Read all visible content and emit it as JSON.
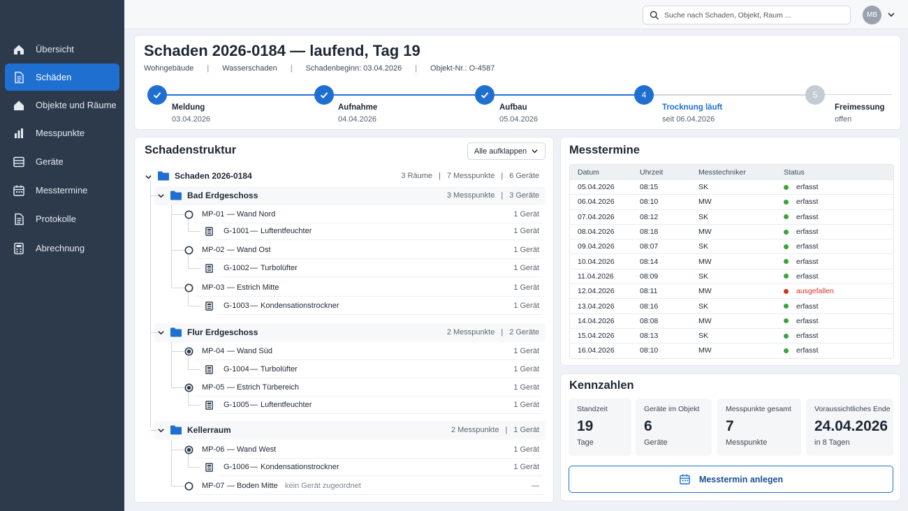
{
  "colors": {
    "accent": "#1f6fd1",
    "sidebar": "#2c3a4b",
    "ok": "#3aa33a",
    "fail": "#d93025"
  },
  "nav": [
    {
      "label": "Übersicht",
      "icon": "home-icon"
    },
    {
      "label": "Schäden",
      "icon": "document-icon",
      "active": true
    },
    {
      "label": "Objekte und Räume",
      "icon": "building-icon"
    },
    {
      "label": "Messpunkte",
      "icon": "bar-chart-icon"
    },
    {
      "label": "Geräte",
      "icon": "device-icon"
    },
    {
      "label": "Messtermine",
      "icon": "calendar-icon"
    },
    {
      "label": "Protokolle",
      "icon": "document-icon"
    },
    {
      "label": "Abrechnung",
      "icon": "calculator-icon"
    }
  ],
  "topbar": {
    "search_placeholder": "Suche nach Schaden, Objekt, Raum ...",
    "avatar_initials": "MB"
  },
  "header": {
    "title": "Schaden 2026-0184 — laufend, Tag 19",
    "meta": [
      "Wohngebäude",
      "Wasserschaden",
      "Schadenbeginn: 03.04.2026",
      "Objekt-Nr.: O-4587"
    ],
    "steps": [
      {
        "number": "1",
        "name": "Meldung",
        "date": "03.04.2026",
        "state": "done"
      },
      {
        "number": "2",
        "name": "Aufnahme",
        "date": "04.04.2026",
        "state": "done"
      },
      {
        "number": "3",
        "name": "Aufbau",
        "date": "05.04.2026",
        "state": "done"
      },
      {
        "number": "4",
        "name": "Trocknung läuft",
        "date": "seit 06.04.2026",
        "state": "current"
      },
      {
        "number": "5",
        "name": "Freimessung",
        "date": "offen",
        "state": "todo"
      }
    ]
  },
  "structure": {
    "title": "Schadenstruktur",
    "expand_label": "Alle aufklappen",
    "root": {
      "name": "Schaden 2026-0184",
      "rooms": "3 Räume",
      "points": "7 Messpunkte",
      "devices": "6 Geräte"
    },
    "rooms": [
      {
        "name": "Bad Erdgeschoss",
        "points": "3 Messpunkte",
        "devices": "3 Geräte",
        "items": [
          {
            "id": "MP-01",
            "label": "Wand Nord",
            "right": "1 Gerät",
            "filled": false,
            "device": {
              "id": "G-1001",
              "label": "Luftentfeuchter",
              "right": "1 Gerät"
            }
          },
          {
            "id": "MP-02",
            "label": "Wand Ost",
            "right": "1 Gerät",
            "filled": false,
            "device": {
              "id": "G-1002",
              "label": "Turbolüfter",
              "right": "1 Gerät"
            }
          },
          {
            "id": "MP-03",
            "label": "Estrich Mitte",
            "right": "1 Gerät",
            "filled": false,
            "device": {
              "id": "G-1003",
              "label": "Kondensationstrockner",
              "right": "1 Gerät"
            }
          }
        ]
      },
      {
        "name": "Flur Erdgeschoss",
        "points": "2 Messpunkte",
        "devices": "2 Geräte",
        "items": [
          {
            "id": "MP-04",
            "label": "Wand Süd",
            "right": "1 Gerät",
            "filled": true,
            "device": {
              "id": "G-1004",
              "label": "Turbolüfter",
              "right": "1 Gerät"
            }
          },
          {
            "id": "MP-05",
            "label": "Estrich Türbereich",
            "right": "1 Gerät",
            "filled": true,
            "device": {
              "id": "G-1005",
              "label": "Luftentfeuchter",
              "right": "1 Gerät"
            }
          }
        ]
      },
      {
        "name": "Kellerraum",
        "points": "2 Messpunkte",
        "devices": "1 Gerät",
        "items": [
          {
            "id": "MP-06",
            "label": "Wand West",
            "right": "1 Gerät",
            "filled": true,
            "device": {
              "id": "G-1006",
              "label": "Kondensationstrockner",
              "right": "1 Gerät"
            }
          },
          {
            "id": "MP-07",
            "label": "Boden Mitte",
            "note": "kein Gerät zugeordnet",
            "right": "—",
            "filled": false
          }
        ]
      }
    ]
  },
  "messtermine": {
    "title": "Messtermine",
    "columns": [
      "Datum",
      "Uhrzeit",
      "Messtechniker",
      "Status"
    ],
    "rows": [
      {
        "date": "05.04.2026",
        "time": "08:15",
        "tech": "SK",
        "status": "erfasst",
        "ok": true
      },
      {
        "date": "06.04.2026",
        "time": "08:10",
        "tech": "MW",
        "status": "erfasst",
        "ok": true
      },
      {
        "date": "07.04.2026",
        "time": "08:12",
        "tech": "SK",
        "status": "erfasst",
        "ok": true
      },
      {
        "date": "08.04.2026",
        "time": "08:18",
        "tech": "MW",
        "status": "erfasst",
        "ok": true
      },
      {
        "date": "09.04.2026",
        "time": "08:07",
        "tech": "SK",
        "status": "erfasst",
        "ok": true
      },
      {
        "date": "10.04.2026",
        "time": "08:14",
        "tech": "MW",
        "status": "erfasst",
        "ok": true
      },
      {
        "date": "11.04.2026",
        "time": "08:09",
        "tech": "SK",
        "status": "erfasst",
        "ok": true
      },
      {
        "date": "12.04.2026",
        "time": "08:11",
        "tech": "MW",
        "status": "ausgefallen",
        "ok": false
      },
      {
        "date": "13.04.2026",
        "time": "08:16",
        "tech": "SK",
        "status": "erfasst",
        "ok": true
      },
      {
        "date": "14.04.2026",
        "time": "08:08",
        "tech": "MW",
        "status": "erfasst",
        "ok": true
      },
      {
        "date": "15.04.2026",
        "time": "08:13",
        "tech": "SK",
        "status": "erfasst",
        "ok": true
      },
      {
        "date": "16.04.2026",
        "time": "08:10",
        "tech": "MW",
        "status": "erfasst",
        "ok": true
      }
    ]
  },
  "kennzahlen": {
    "title": "Kennzahlen",
    "cards": [
      {
        "label": "Standzeit",
        "value": "19",
        "sub": "Tage"
      },
      {
        "label": "Geräte im Objekt",
        "value": "6",
        "sub": "Geräte"
      },
      {
        "label": "Messpunkte gesamt",
        "value": "7",
        "sub": "Messpunkte"
      },
      {
        "label": "Voraussichtliches Ende",
        "value": "24.04.2026",
        "sub": "in 8 Tagen"
      }
    ],
    "button_label": "Messtermin anlegen"
  }
}
